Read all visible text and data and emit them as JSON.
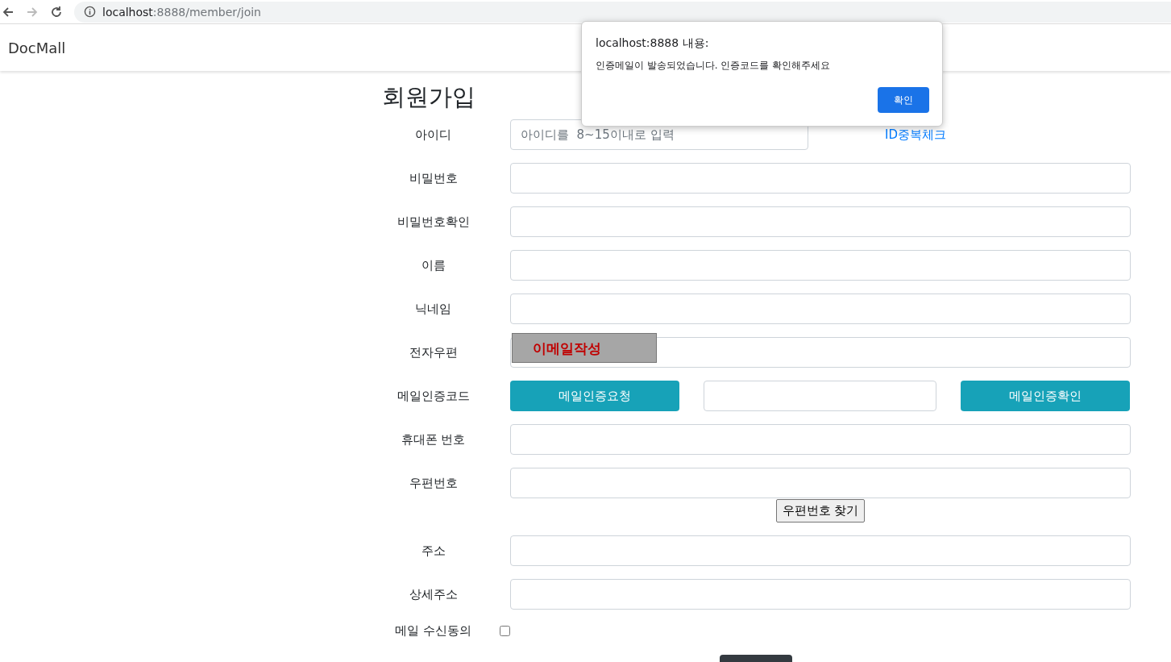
{
  "browser": {
    "url_host": "localhost",
    "url_rest": ":8888/member/join"
  },
  "navbar": {
    "brand": "DocMall"
  },
  "form": {
    "title": "회원가입",
    "rows": [
      {
        "kind": "text",
        "label": "아이디",
        "placeholder": "아이디를  8~15이내로 입력",
        "link": "ID중복체크"
      },
      {
        "kind": "text",
        "label": "비밀번호"
      },
      {
        "kind": "text",
        "label": "비밀번호확인"
      },
      {
        "kind": "text",
        "label": "이름"
      },
      {
        "kind": "text",
        "label": "닉네임"
      },
      {
        "kind": "email",
        "label": "전자우편",
        "overlay": "이메일작성"
      },
      {
        "kind": "mailcode",
        "label": "메일인증코드",
        "request_button": "메일인증요청",
        "confirm_button": "메일인증확인"
      },
      {
        "kind": "text",
        "label": "휴대폰 번호"
      },
      {
        "kind": "zip",
        "label": "우편번호",
        "button": "우편번호 찾기"
      },
      {
        "kind": "text",
        "label": "주소"
      },
      {
        "kind": "text",
        "label": "상세주소"
      },
      {
        "kind": "checkbox",
        "label": "메일 수신동의",
        "checked": false
      }
    ]
  },
  "dialog": {
    "title": "localhost:8888 내용:",
    "message": "인증메일이 발송되었습니다. 인증코드를 확인해주세요",
    "button": "확인"
  }
}
